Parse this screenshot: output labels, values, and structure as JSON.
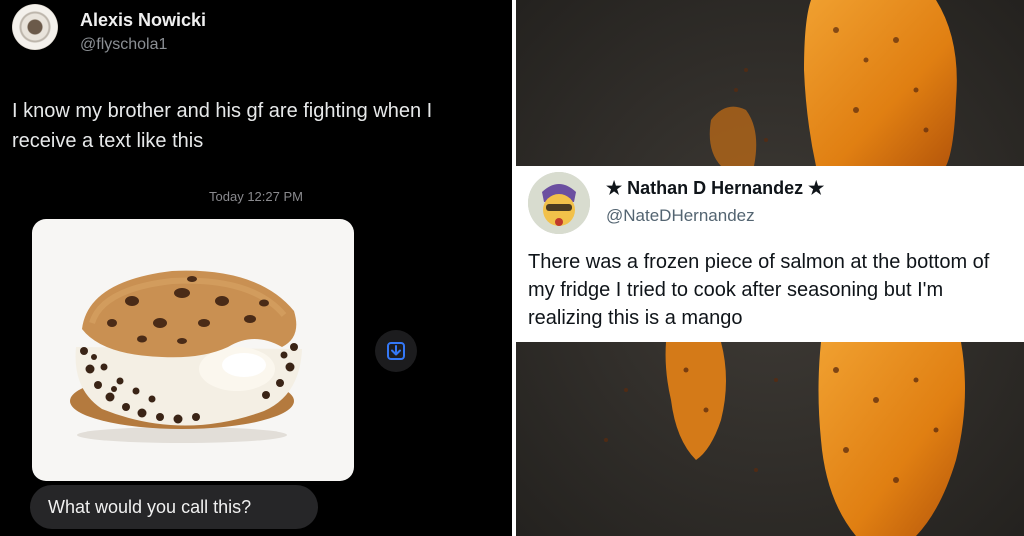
{
  "left_tweet": {
    "author_name": "Alexis Nowicki",
    "author_handle": "@flyschola1",
    "text": "I know my brother and his gf are fighting when I receive a text like this",
    "message_timestamp": "Today 12:27 PM",
    "message_text": "What would you call this?",
    "image_subject": "ice-cream-cookie-sandwich",
    "share_icon": "download-icon"
  },
  "right_tweet": {
    "author_name": "★ Nathan D Hernandez ★",
    "author_handle": "@NateDHernandez",
    "text": "There was a frozen piece of salmon at the bottom of my fridge I tried to cook after seasoning but I'm realizing this is a mango",
    "image_subject": "seasoned-mango-in-pan"
  },
  "colors": {
    "left_background": "#000000",
    "bubble": "#262628",
    "share_accent": "#3478f6",
    "pan": "#3a3632",
    "mango": "#e8901c"
  }
}
